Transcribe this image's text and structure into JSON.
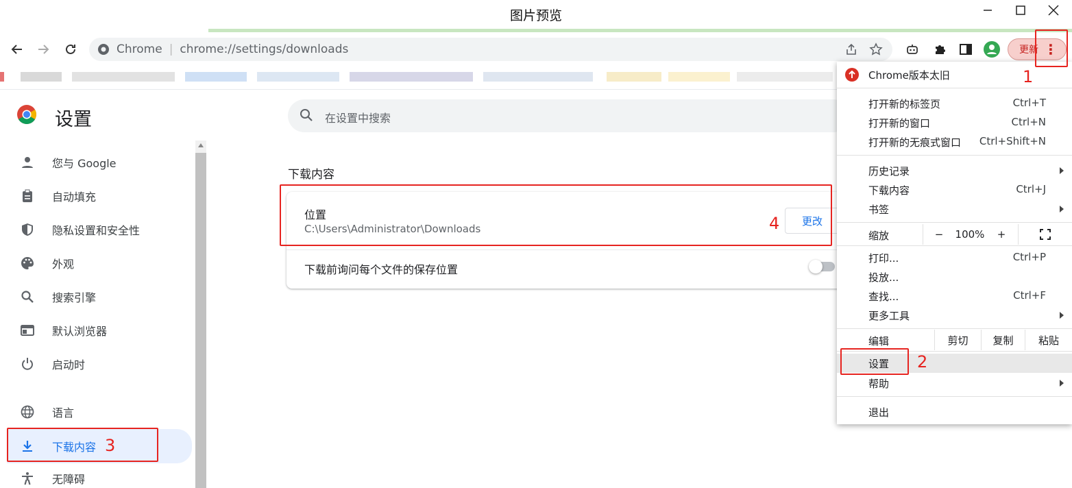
{
  "window": {
    "title": "图片预览"
  },
  "omnibox": {
    "site_label": "Chrome",
    "separator": "|",
    "url": "chrome://settings/downloads"
  },
  "toolbar": {
    "update_label": "更新"
  },
  "settings": {
    "title": "设置",
    "search_placeholder": "在设置中搜索",
    "nav": [
      {
        "label": "您与 Google",
        "icon": "person-icon"
      },
      {
        "label": "自动填充",
        "icon": "clipboard-icon"
      },
      {
        "label": "隐私设置和安全性",
        "icon": "shield-icon"
      },
      {
        "label": "外观",
        "icon": "palette-icon"
      },
      {
        "label": "搜索引擎",
        "icon": "search-icon"
      },
      {
        "label": "默认浏览器",
        "icon": "browser-icon"
      },
      {
        "label": "启动时",
        "icon": "power-icon"
      },
      {
        "label": "语言",
        "icon": "globe-icon"
      },
      {
        "label": "下载内容",
        "icon": "download-icon",
        "active": true
      },
      {
        "label": "无障碍",
        "icon": "accessibility-icon"
      }
    ],
    "downloads": {
      "section_title": "下载内容",
      "location_label": "位置",
      "location_path": "C:\\Users\\Administrator\\Downloads",
      "change_button": "更改",
      "ask_label": "下载前询问每个文件的保存位置",
      "ask_enabled": false
    }
  },
  "menu": {
    "update_notice": "Chrome版本太旧",
    "items": {
      "new_tab": {
        "label": "打开新的标签页",
        "shortcut": "Ctrl+T"
      },
      "new_window": {
        "label": "打开新的窗口",
        "shortcut": "Ctrl+N"
      },
      "incognito": {
        "label": "打开新的无痕式窗口",
        "shortcut": "Ctrl+Shift+N"
      },
      "history": {
        "label": "历史记录"
      },
      "downloads": {
        "label": "下载内容",
        "shortcut": "Ctrl+J"
      },
      "bookmarks": {
        "label": "书签"
      },
      "print": {
        "label": "打印...",
        "shortcut": "Ctrl+P"
      },
      "cast": {
        "label": "投放..."
      },
      "find": {
        "label": "查找...",
        "shortcut": "Ctrl+F"
      },
      "more_tools": {
        "label": "更多工具"
      },
      "settings": {
        "label": "设置"
      },
      "help": {
        "label": "帮助"
      },
      "exit": {
        "label": "退出"
      }
    },
    "zoom": {
      "label": "缩放",
      "minus": "−",
      "value": "100%",
      "plus": "+"
    },
    "edit": {
      "label": "编辑",
      "cut": "剪切",
      "copy": "复制",
      "paste": "粘贴"
    }
  },
  "annotations": {
    "one": "1",
    "two": "2",
    "three": "3",
    "four": "4"
  },
  "colors": {
    "annotation": "#e6231f",
    "accent": "#1a73e8",
    "update_bg": "#f7cfcc"
  }
}
